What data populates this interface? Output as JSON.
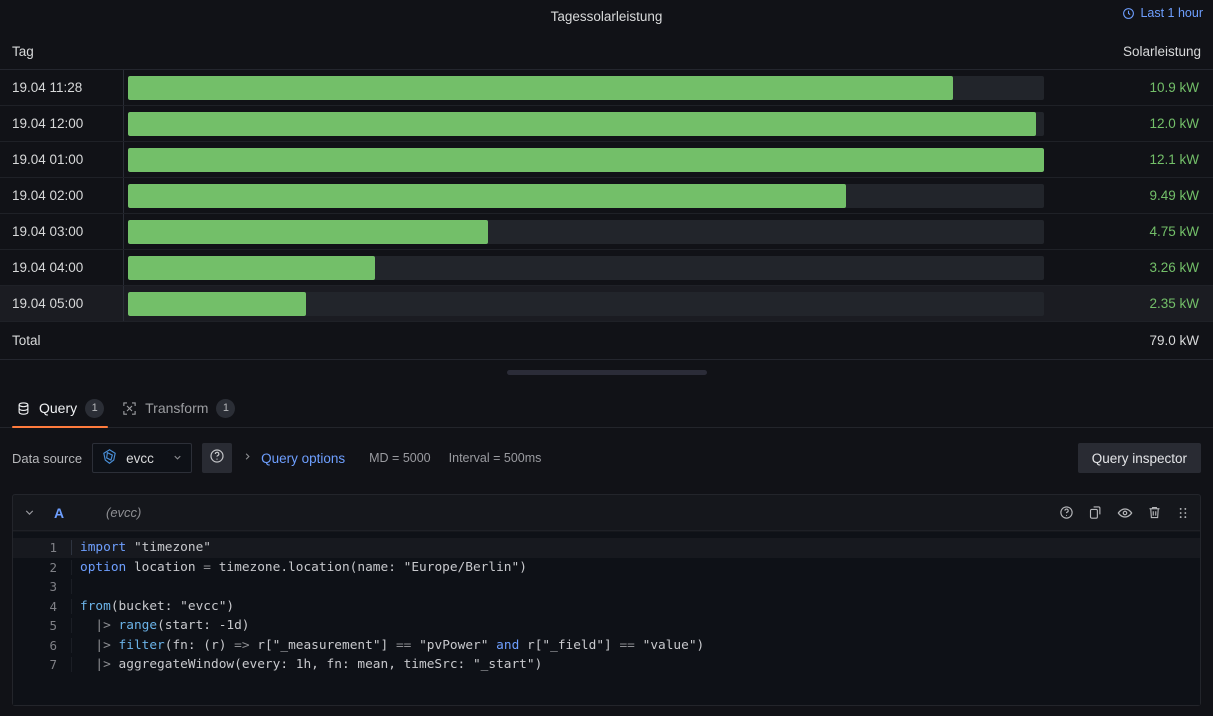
{
  "panel": {
    "title": "Tagessolarleistung",
    "time_range": "Last 1 hour",
    "time_icon": "clock-icon"
  },
  "table": {
    "columns": {
      "tag": "Tag",
      "value": "Solarleistung"
    },
    "rows": [
      {
        "tag": "19.04 11:28",
        "value": "10.9 kW",
        "num": 10.9
      },
      {
        "tag": "19.04 12:00",
        "value": "12.0 kW",
        "num": 12.0
      },
      {
        "tag": "19.04 01:00",
        "value": "12.1 kW",
        "num": 12.1
      },
      {
        "tag": "19.04 02:00",
        "value": "9.49 kW",
        "num": 9.49
      },
      {
        "tag": "19.04 03:00",
        "value": "4.75 kW",
        "num": 4.75
      },
      {
        "tag": "19.04 04:00",
        "value": "3.26 kW",
        "num": 3.26
      },
      {
        "tag": "19.04 05:00",
        "value": "2.35 kW",
        "num": 2.35
      }
    ],
    "footer": {
      "label": "Total",
      "value": "79.0 kW"
    },
    "gauge_max": 12.1,
    "gauge_color": "#73bf69"
  },
  "tabs": [
    {
      "label": "Query",
      "badge": "1",
      "icon": "database-icon",
      "active": true
    },
    {
      "label": "Transform",
      "badge": "1",
      "icon": "transform-icon",
      "active": false
    }
  ],
  "query_options": {
    "datasource_label": "Data source",
    "datasource_name": "evcc",
    "datasource_icon": "influxdb-icon",
    "help_icon": "help-circle-icon",
    "expand_icon": "chevron-right-icon",
    "options_label": "Query options",
    "max_data_points": "MD = 5000",
    "interval": "Interval = 500ms",
    "inspector_label": "Query inspector"
  },
  "query_row": {
    "ref_id": "A",
    "datasource": "(evcc)",
    "collapse_icon": "chevron-down-icon",
    "actions": [
      "help-circle-icon",
      "duplicate-icon",
      "eye-icon",
      "trash-icon",
      "drag-handle-icon"
    ]
  },
  "code": {
    "lines": [
      {
        "n": "1",
        "current": true,
        "tokens": [
          {
            "t": "import",
            "c": "kw"
          },
          {
            "t": " ",
            "c": "op"
          },
          {
            "t": "\"timezone\"",
            "c": "str"
          }
        ]
      },
      {
        "n": "2",
        "current": false,
        "tokens": [
          {
            "t": "option",
            "c": "kw"
          },
          {
            "t": " location ",
            "c": "str"
          },
          {
            "t": "=",
            "c": "op"
          },
          {
            "t": " timezone.location(name: ",
            "c": "str"
          },
          {
            "t": "\"Europe/Berlin\"",
            "c": "str"
          },
          {
            "t": ")",
            "c": "str"
          }
        ]
      },
      {
        "n": "3",
        "current": false,
        "tokens": []
      },
      {
        "n": "4",
        "current": false,
        "tokens": [
          {
            "t": "from",
            "c": "fn"
          },
          {
            "t": "(bucket: ",
            "c": "str"
          },
          {
            "t": "\"evcc\"",
            "c": "str"
          },
          {
            "t": ")",
            "c": "str"
          }
        ]
      },
      {
        "n": "5",
        "current": false,
        "tokens": [
          {
            "t": "  |> ",
            "c": "pipe"
          },
          {
            "t": "range",
            "c": "fn"
          },
          {
            "t": "(start: -1d)",
            "c": "str"
          }
        ]
      },
      {
        "n": "6",
        "current": false,
        "tokens": [
          {
            "t": "  |> ",
            "c": "pipe"
          },
          {
            "t": "filter",
            "c": "fn"
          },
          {
            "t": "(fn: (r) ",
            "c": "str"
          },
          {
            "t": "=>",
            "c": "op"
          },
          {
            "t": " r[",
            "c": "str"
          },
          {
            "t": "\"_measurement\"",
            "c": "str"
          },
          {
            "t": "] ",
            "c": "str"
          },
          {
            "t": "==",
            "c": "op"
          },
          {
            "t": " ",
            "c": "str"
          },
          {
            "t": "\"pvPower\"",
            "c": "str"
          },
          {
            "t": " ",
            "c": "str"
          },
          {
            "t": "and",
            "c": "kw"
          },
          {
            "t": " r[",
            "c": "str"
          },
          {
            "t": "\"_field\"",
            "c": "str"
          },
          {
            "t": "] ",
            "c": "str"
          },
          {
            "t": "==",
            "c": "op"
          },
          {
            "t": " ",
            "c": "str"
          },
          {
            "t": "\"value\"",
            "c": "str"
          },
          {
            "t": ")",
            "c": "str"
          }
        ]
      },
      {
        "n": "7",
        "current": false,
        "tokens": [
          {
            "t": "  |> ",
            "c": "pipe"
          },
          {
            "t": "aggregateWindow",
            "c": "str"
          },
          {
            "t": "(every: 1h, fn: mean, timeSrc: ",
            "c": "str"
          },
          {
            "t": "\"_start\"",
            "c": "str"
          },
          {
            "t": ")",
            "c": "str"
          }
        ]
      }
    ],
    "raw": "import \"timezone\"\noption location = timezone.location(name: \"Europe/Berlin\")\n\nfrom(bucket: \"evcc\")\n  |> range(start: -1d)\n  |> filter(fn: (r) => r[\"_measurement\"] == \"pvPower\" and r[\"_field\"] == \"value\")\n  |> aggregateWindow(every: 1h, fn: mean, timeSrc: \"_start\")"
  },
  "chart_data": {
    "type": "bar",
    "title": "Tagessolarleistung",
    "categories": [
      "19.04 11:28",
      "19.04 12:00",
      "19.04 01:00",
      "19.04 02:00",
      "19.04 03:00",
      "19.04 04:00",
      "19.04 05:00"
    ],
    "values": [
      10.9,
      12.0,
      12.1,
      9.49,
      4.75,
      3.26,
      2.35
    ],
    "unit": "kW",
    "xlabel": "Tag",
    "ylabel": "Solarleistung",
    "total": 79.0,
    "ylim": [
      0,
      12.1
    ],
    "grid": false,
    "legend": "none",
    "color": "#73bf69"
  }
}
